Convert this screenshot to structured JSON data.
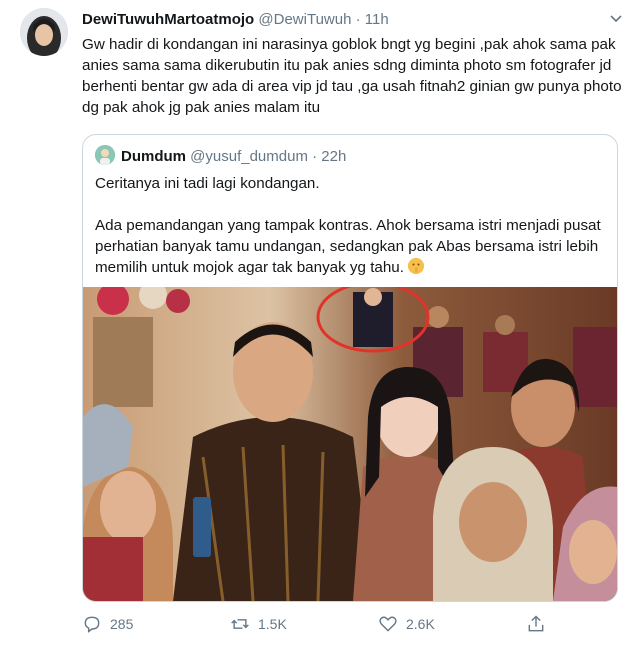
{
  "tweet": {
    "display_name": "DewiTuwuhMartoatmojo",
    "handle": "@DewiTuwuh",
    "separator": "·",
    "time": "11h",
    "text": "Gw hadir di kondangan ini narasinya goblok bngt yg begini ,pak ahok sama pak anies sama sama dikerubutin itu pak anies sdng diminta photo sm fotografer jd berhenti bentar gw ada di area vip jd tau ,ga usah fitnah2 ginian gw punya photo dg pak ahok jg pak anies malam itu"
  },
  "quoted": {
    "display_name": "Dumdum",
    "handle": "@yusuf_dumdum",
    "separator": "·",
    "time": "22h",
    "line1": "Ceritanya ini tadi lagi kondangan.",
    "line2": "Ada pemandangan yang tampak kontras. Ahok bersama istri menjadi pusat perhatian banyak tamu undangan, sedangkan pak Abas bersama istri lebih memilih untuk mojok agar tak banyak yg tahu."
  },
  "actions": {
    "reply_count": "285",
    "retweet_count": "1.5K",
    "like_count": "2.6K"
  },
  "icons": {
    "reply": "reply-icon",
    "retweet": "retweet-icon",
    "like": "heart-icon",
    "share": "share-icon",
    "more": "chevron-down-icon",
    "emoji": "shushing-face-emoji"
  },
  "colors": {
    "text": "#14171a",
    "secondary": "#657786",
    "border": "#ccd6dd",
    "highlight_circle": "#e0342b"
  }
}
